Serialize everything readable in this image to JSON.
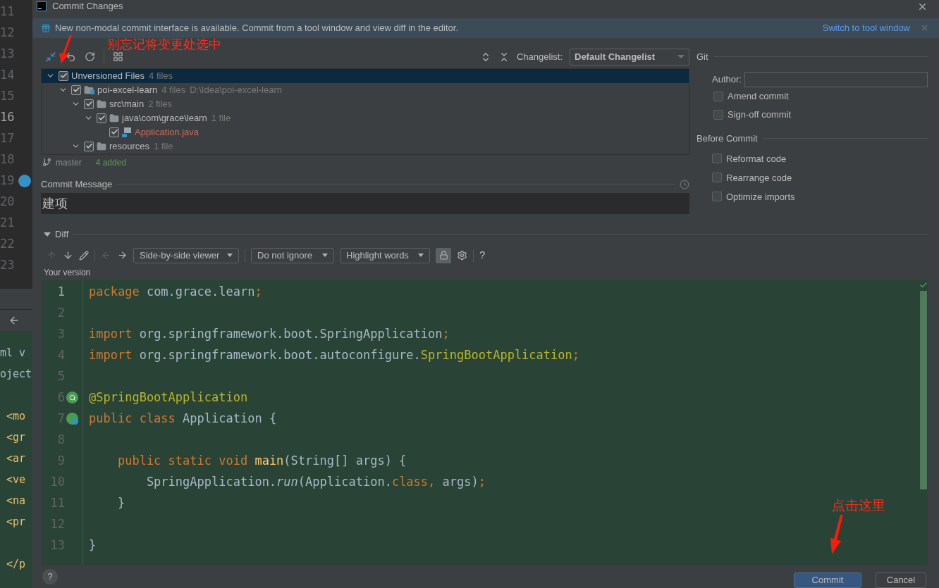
{
  "background_editor": {
    "line_numbers": [
      {
        "number": "11",
        "current": false,
        "marker": false
      },
      {
        "number": "12",
        "current": false,
        "marker": false
      },
      {
        "number": "13",
        "current": false,
        "marker": false
      },
      {
        "number": "14",
        "current": false,
        "marker": false
      },
      {
        "number": "15",
        "current": false,
        "marker": false
      },
      {
        "number": "16",
        "current": true,
        "marker": false
      },
      {
        "number": "17",
        "current": false,
        "marker": false
      },
      {
        "number": "18",
        "current": false,
        "marker": false
      },
      {
        "number": "19",
        "current": false,
        "marker": true
      },
      {
        "number": "20",
        "current": false,
        "marker": false
      },
      {
        "number": "21",
        "current": false,
        "marker": false
      },
      {
        "number": "22",
        "current": false,
        "marker": false
      },
      {
        "number": "23",
        "current": false,
        "marker": false
      }
    ],
    "xml_lines": [
      {
        "kind": "text",
        "text": "ml v"
      },
      {
        "kind": "text",
        "text": "oject"
      },
      {
        "kind": "blank"
      },
      {
        "kind": "tag",
        "text": "<mo"
      },
      {
        "kind": "tag",
        "text": "<gr"
      },
      {
        "kind": "tag",
        "text": "<ar"
      },
      {
        "kind": "tag",
        "text": "<ve"
      },
      {
        "kind": "tag",
        "text": "<na"
      },
      {
        "kind": "tag",
        "text": "<pr"
      },
      {
        "kind": "blank"
      },
      {
        "kind": "tag",
        "text": "</p"
      }
    ]
  },
  "window": {
    "title": "Commit Changes"
  },
  "banner": {
    "text": "New non-modal commit interface is available. Commit from a tool window and view diff in the editor.",
    "link": "Switch to tool window"
  },
  "changes": {
    "changelist_label": "Changelist:",
    "changelist": "Default Changelist",
    "tree": [
      {
        "label": "Unversioned Files",
        "count": "4 files",
        "checked": true,
        "expanded": true,
        "selected": true,
        "children": [
          {
            "label": "poi-excel-learn",
            "count": "4 files",
            "path": "D:\\Idea\\poi-excel-learn",
            "kind": "module",
            "checked": true,
            "expanded": true,
            "selected": false,
            "children": [
              {
                "label": "src\\main",
                "count": "2 files",
                "kind": "folder",
                "checked": true,
                "expanded": true,
                "selected": false,
                "children": [
                  {
                    "label": "java\\com\\grace\\learn",
                    "count": "1 file",
                    "kind": "folder",
                    "checked": true,
                    "expanded": true,
                    "selected": false,
                    "children": [
                      {
                        "label": "Application.java",
                        "kind": "file",
                        "checked": true,
                        "selected": false
                      }
                    ]
                  }
                ]
              },
              {
                "label": "resources",
                "count": "1 file",
                "kind": "folder",
                "checked": true,
                "expanded": true,
                "selected": false
              }
            ]
          }
        ]
      }
    ],
    "branch": "master",
    "status": "4 added"
  },
  "commit_message": {
    "label": "Commit Message",
    "value": "建项"
  },
  "git": {
    "title": "Git",
    "author_label": "Author:",
    "options": [
      {
        "label": "Amend commit",
        "checked": false
      },
      {
        "label": "Sign-off commit",
        "checked": false
      }
    ]
  },
  "before_commit": {
    "title": "Before Commit",
    "options": [
      {
        "label": "Reformat code",
        "checked": false
      },
      {
        "label": "Rearrange code",
        "checked": false
      },
      {
        "label": "Optimize imports",
        "checked": false
      }
    ]
  },
  "diff": {
    "title": "Diff",
    "expanded": true,
    "viewer": "Side-by-side viewer",
    "ignore": "Do not ignore",
    "highlight": "Highlight words",
    "help": "?",
    "version_label": "Your version",
    "lines": [
      {
        "number": "1",
        "current": true,
        "kind": "plain",
        "tokens": [
          {
            "kind": "keyword",
            "text": "package "
          },
          {
            "kind": "plain",
            "text": "com.grace.learn"
          },
          {
            "kind": "keyword",
            "text": ";"
          }
        ]
      },
      {
        "number": "2",
        "current": false,
        "kind": "plain"
      },
      {
        "number": "3",
        "current": false,
        "kind": "plain",
        "tokens": [
          {
            "kind": "keyword",
            "text": "import "
          },
          {
            "kind": "plain",
            "text": "org.springframework.boot.SpringApplication"
          },
          {
            "kind": "keyword",
            "text": ";"
          }
        ]
      },
      {
        "number": "4",
        "current": false,
        "kind": "plain",
        "tokens": [
          {
            "kind": "keyword",
            "text": "import "
          },
          {
            "kind": "plain",
            "text": "org.springframework.boot.autoconfigure."
          },
          {
            "kind": "annotation",
            "text": "SpringBootApplication"
          },
          {
            "kind": "keyword",
            "text": ";"
          }
        ]
      },
      {
        "number": "5",
        "current": false,
        "kind": "plain"
      },
      {
        "number": "6",
        "current": false,
        "kind": "bean_search",
        "tokens": [
          {
            "kind": "annotation",
            "text": "@SpringBootApplication"
          }
        ]
      },
      {
        "number": "7",
        "current": false,
        "kind": "bean_run",
        "tokens": [
          {
            "kind": "keyword",
            "text": "public class "
          },
          {
            "kind": "plain",
            "text": "Application {"
          }
        ]
      },
      {
        "number": "8",
        "current": false,
        "kind": "plain"
      },
      {
        "number": "9",
        "current": false,
        "kind": "plain",
        "tokens": [
          {
            "kind": "keyword",
            "text": "    public static void "
          },
          {
            "kind": "method",
            "text": "main"
          },
          {
            "kind": "plain",
            "text": "(String[] args) {"
          }
        ]
      },
      {
        "number": "10",
        "current": false,
        "kind": "plain",
        "tokens": [
          {
            "kind": "plain",
            "text": "        SpringApplication."
          },
          {
            "kind": "italic",
            "text": "run"
          },
          {
            "kind": "plain",
            "text": "(Application."
          },
          {
            "kind": "keyword",
            "text": "class, "
          },
          {
            "kind": "plain",
            "text": "args)"
          },
          {
            "kind": "keyword",
            "text": ";"
          }
        ]
      },
      {
        "number": "11",
        "current": false,
        "kind": "plain",
        "tokens": [
          {
            "kind": "plain",
            "text": "    }"
          }
        ]
      },
      {
        "number": "12",
        "current": false,
        "kind": "plain"
      },
      {
        "number": "13",
        "current": false,
        "kind": "plain",
        "tokens": [
          {
            "kind": "plain",
            "text": "}"
          }
        ]
      }
    ]
  },
  "buttons": [
    {
      "label": "Commit",
      "kind": "primary"
    },
    {
      "label": "Cancel",
      "kind": "secondary"
    }
  ],
  "help_button": "?",
  "annotations": [
    {
      "text": "别忘记将变更处选中",
      "kind": "top"
    },
    {
      "text": "点击这里",
      "kind": "bottom"
    }
  ]
}
